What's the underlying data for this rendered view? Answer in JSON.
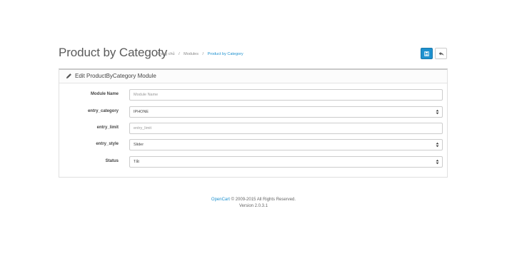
{
  "header": {
    "title": "Product by Categoty",
    "breadcrumb": [
      "Trang chủ",
      "Modules",
      "Product by Category"
    ],
    "separator": "/"
  },
  "toolbar": {
    "save_icon": "save-icon",
    "back_icon": "reply-icon"
  },
  "panel": {
    "title": "Edit ProductByCategory Module",
    "icon": "pencil-icon"
  },
  "form": {
    "module_name": {
      "label": "Module Name",
      "placeholder": "Module Name",
      "value": ""
    },
    "entry_category": {
      "label": "entry_category",
      "value": "IPHONE"
    },
    "entry_limit": {
      "label": "entry_limit",
      "placeholder": "entry_limit",
      "value": ""
    },
    "entry_style": {
      "label": "entry_style",
      "value": "Slider"
    },
    "status": {
      "label": "Status",
      "value": "Tắt"
    }
  },
  "footer": {
    "link": "OpenCart",
    "copyright": "© 2009-2015 All Rights Reserved.",
    "version": "Version 2.0.3.1"
  },
  "colors": {
    "accent": "#1e91cf"
  }
}
